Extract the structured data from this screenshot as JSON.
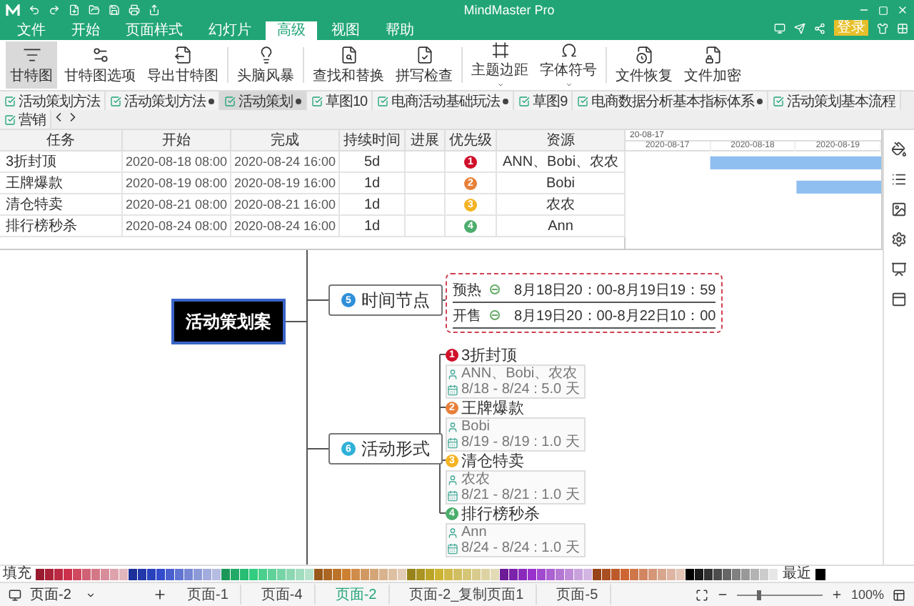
{
  "app": {
    "title": "MindMaster Pro",
    "login": "登录"
  },
  "menu": [
    {
      "label": "文件",
      "selected": false
    },
    {
      "label": "开始",
      "selected": false
    },
    {
      "label": "页面样式",
      "selected": false
    },
    {
      "label": "幻灯片",
      "selected": false
    },
    {
      "label": "高级",
      "selected": true
    },
    {
      "label": "视图",
      "selected": false
    },
    {
      "label": "帮助",
      "selected": false
    }
  ],
  "ribbon": [
    {
      "label": "甘特图",
      "selected": true,
      "dropdown": false
    },
    {
      "label": "甘特图选项",
      "selected": false,
      "dropdown": false
    },
    {
      "label": "导出甘特图",
      "selected": false,
      "dropdown": false
    },
    {
      "label": "头脑风暴",
      "selected": false,
      "dropdown": false
    },
    {
      "label": "查找和替换",
      "selected": false,
      "dropdown": false
    },
    {
      "label": "拼写检查",
      "selected": false,
      "dropdown": false
    },
    {
      "label": "主题边距",
      "selected": false,
      "dropdown": true
    },
    {
      "label": "字体符号",
      "selected": false,
      "dropdown": true
    },
    {
      "label": "文件恢复",
      "selected": false,
      "dropdown": false
    },
    {
      "label": "文件加密",
      "selected": false,
      "dropdown": false
    }
  ],
  "documents": [
    {
      "title": "活动策划方法",
      "selected": false,
      "modified": false
    },
    {
      "title": "活动策划方法",
      "selected": false,
      "modified": true
    },
    {
      "title": "活动策划",
      "selected": true,
      "modified": true
    },
    {
      "title": "草图10",
      "selected": false,
      "modified": false
    },
    {
      "title": "电商活动基础玩法",
      "selected": false,
      "modified": true
    },
    {
      "title": "草图9",
      "selected": false,
      "modified": false
    },
    {
      "title": "电商数据分析基本指标体系",
      "selected": false,
      "modified": true
    },
    {
      "title": "活动策划基本流程",
      "selected": false,
      "modified": false
    },
    {
      "title": "营销",
      "selected": false,
      "modified": false
    }
  ],
  "gantt": {
    "columns": [
      "任务",
      "开始",
      "完成",
      "持续时间",
      "进展",
      "优先级",
      "资源"
    ],
    "rows": [
      {
        "task": "3折封顶",
        "start": "2020-08-18 08:00",
        "finish": "2020-08-24 16:00",
        "duration": "5d",
        "priority": "1",
        "color": "#d0102a",
        "resources": "ANN、Bobi、农农"
      },
      {
        "task": "王牌爆款",
        "start": "2020-08-19 08:00",
        "finish": "2020-08-19 16:00",
        "duration": "1d",
        "priority": "2",
        "color": "#e8803a",
        "resources": "Bobi"
      },
      {
        "task": "清仓特卖",
        "start": "2020-08-21 08:00",
        "finish": "2020-08-21 16:00",
        "duration": "1d",
        "priority": "3",
        "color": "#f5b324",
        "resources": "农农"
      },
      {
        "task": "排行榜秒杀",
        "start": "2020-08-24 08:00",
        "finish": "2020-08-24 16:00",
        "duration": "1d",
        "priority": "4",
        "color": "#4cae6c",
        "resources": "Ann"
      }
    ],
    "timeline": {
      "range": "20-08-17",
      "dates": [
        "2020-08-17",
        "2020-08-18",
        "2020-08-19"
      ]
    }
  },
  "mindmap": {
    "root": "活动策划案",
    "branches": [
      {
        "label": "时间节点",
        "badge": "5",
        "color": "#2f8fd8",
        "kind": "table",
        "rows": [
          {
            "name": "预热",
            "time": "8月18日20：00-8月19日19：59"
          },
          {
            "name": "开售",
            "time": "8月19日20：00-8月22日10：00"
          }
        ]
      },
      {
        "label": "活动形式",
        "badge": "6",
        "color": "#2fb0d8",
        "kind": "tasks",
        "children": [
          {
            "label": "3折封顶",
            "priority": "1",
            "color": "#d0102a",
            "resources": "ANN、Bobi、农农",
            "dates": "8/18 - 8/24 : 5.0 天"
          },
          {
            "label": "王牌爆款",
            "priority": "2",
            "color": "#e8803a",
            "resources": "Bobi",
            "dates": "8/19 - 8/19 : 1.0 天"
          },
          {
            "label": "清仓特卖",
            "priority": "3",
            "color": "#f5b324",
            "resources": "农农",
            "dates": "8/21 - 8/21 : 1.0 天"
          },
          {
            "label": "排行榜秒杀",
            "priority": "4",
            "color": "#4cae6c",
            "resources": "Ann",
            "dates": "8/24 - 8/24 : 1.0 天"
          }
        ]
      }
    ]
  },
  "palette": {
    "fill_label": "填充",
    "recent_label": "最近"
  },
  "pages": {
    "current": "页面-2",
    "tabs": [
      {
        "label": "页面-1",
        "selected": false
      },
      {
        "label": "页面-4",
        "selected": false
      },
      {
        "label": "页面-2",
        "selected": true
      },
      {
        "label": "页面-2_复制页面1",
        "selected": false
      },
      {
        "label": "页面-5",
        "selected": false
      }
    ],
    "zoom": "100%",
    "zoom_slider": {
      "level": 0.25
    }
  }
}
